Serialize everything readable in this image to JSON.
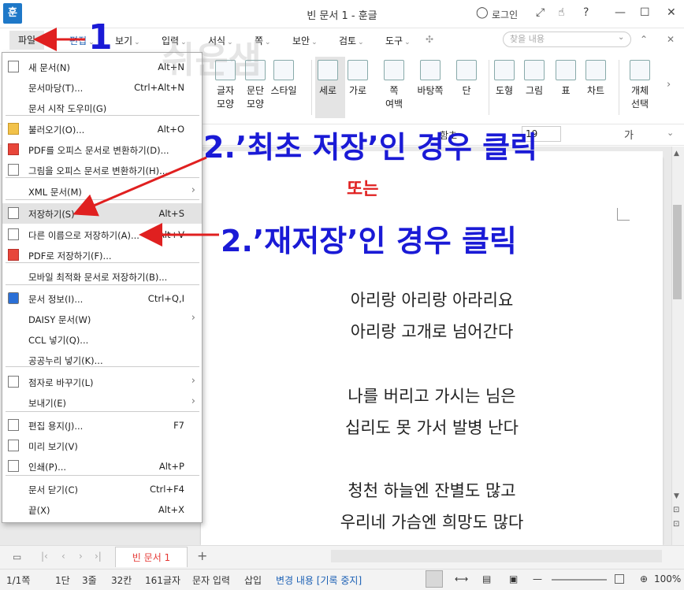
{
  "window": {
    "title": "빈 문서 1 - 훈글",
    "app_logo": "훈",
    "login_label": "로그인",
    "help_label": "?"
  },
  "menubar": {
    "items": [
      "파일",
      "편집",
      "보기",
      "입력",
      "서식",
      "쪽",
      "보안",
      "검토",
      "도구"
    ],
    "search_placeholder": "찾을 내용"
  },
  "toolbar": {
    "tools": [
      {
        "label": "글자",
        "label2": "모양",
        "icon": "char-shape-icon"
      },
      {
        "label": "문단",
        "label2": "모양",
        "icon": "para-shape-icon"
      },
      {
        "label": "스타일",
        "label2": "",
        "icon": "style-icon"
      },
      {
        "label": "세로",
        "label2": "",
        "icon": "portrait-icon"
      },
      {
        "label": "가로",
        "label2": "",
        "icon": "landscape-icon"
      },
      {
        "label": "쪽",
        "label2": "여백",
        "icon": "margin-icon"
      },
      {
        "label": "바탕쪽",
        "label2": "",
        "icon": "master-page-icon"
      },
      {
        "label": "단",
        "label2": "",
        "icon": "columns-icon"
      },
      {
        "label": "도형",
        "label2": "",
        "icon": "shape-icon"
      },
      {
        "label": "그림",
        "label2": "",
        "icon": "picture-icon"
      },
      {
        "label": "표",
        "label2": "",
        "icon": "table-icon"
      },
      {
        "label": "차트",
        "label2": "",
        "icon": "chart-icon"
      },
      {
        "label": "개체",
        "label2": "선택",
        "icon": "select-object-icon"
      }
    ]
  },
  "formatbar": {
    "font_partial": "함초",
    "size": "19",
    "sample_char": "가"
  },
  "file_menu": {
    "items": [
      {
        "label": "새 문서(N)",
        "shortcut": "Alt+N",
        "arrow": ""
      },
      {
        "label": "문서마당(T)...",
        "shortcut": "Ctrl+Alt+N",
        "arrow": ""
      },
      {
        "label": "문서 시작 도우미(G)",
        "shortcut": "",
        "arrow": ""
      },
      {
        "label": "불러오기(O)...",
        "shortcut": "Alt+O",
        "arrow": ""
      },
      {
        "label": "PDF를 오피스 문서로 변환하기(D)...",
        "shortcut": "",
        "arrow": ""
      },
      {
        "label": "그림을 오피스 문서로 변환하기(H)...",
        "shortcut": "",
        "arrow": ""
      },
      {
        "label": "XML 문서(M)",
        "shortcut": "",
        "arrow": "›"
      },
      {
        "label": "저장하기(S)",
        "shortcut": "Alt+S",
        "arrow": ""
      },
      {
        "label": "다른 이름으로 저장하기(A)...",
        "shortcut": "Alt+V",
        "arrow": ""
      },
      {
        "label": "PDF로 저장하기(F)...",
        "shortcut": "",
        "arrow": ""
      },
      {
        "label": "모바일 최적화 문서로 저장하기(B)...",
        "shortcut": "",
        "arrow": ""
      },
      {
        "label": "문서 정보(I)...",
        "shortcut": "Ctrl+Q,I",
        "arrow": ""
      },
      {
        "label": "DAISY 문서(W)",
        "shortcut": "",
        "arrow": "›"
      },
      {
        "label": "CCL 넣기(Q)...",
        "shortcut": "",
        "arrow": ""
      },
      {
        "label": "공공누리 넣기(K)...",
        "shortcut": "",
        "arrow": ""
      },
      {
        "label": "점자로 바꾸기(L)",
        "shortcut": "",
        "arrow": "›"
      },
      {
        "label": "보내기(E)",
        "shortcut": "",
        "arrow": "›"
      },
      {
        "label": "편집 용지(J)...",
        "shortcut": "F7",
        "arrow": ""
      },
      {
        "label": "미리 보기(V)",
        "shortcut": "",
        "arrow": ""
      },
      {
        "label": "인쇄(P)...",
        "shortcut": "Alt+P",
        "arrow": ""
      },
      {
        "label": "문서 닫기(C)",
        "shortcut": "Ctrl+F4",
        "arrow": ""
      },
      {
        "label": "끝(X)",
        "shortcut": "Alt+X",
        "arrow": ""
      }
    ]
  },
  "document": {
    "lines": [
      "아리랑 아리랑 아라리요",
      "아리랑 고개로 넘어간다",
      "나를 버리고 가시는 님은",
      "십리도 못 가서 발병 난다",
      "청천 하늘엔 잔별도 많고",
      "우리네 가슴엔 희망도 많다"
    ]
  },
  "tabs": {
    "doc_tab": "빈 문서 1",
    "add": "+"
  },
  "statusbar": {
    "page": "1/1쪽",
    "column": "1단",
    "line": "3줄",
    "col": "32칸",
    "chars": "161글자",
    "mode": "문자 입력",
    "insert": "삽입",
    "track": "변경 내용 [기록 중지]",
    "zoom": "100%"
  },
  "annotations": {
    "step1": "1",
    "step2_first": "2.’최초 저장’인 경우 클릭",
    "or": "또는",
    "step2_resave": "2.’재저장’인 경우 클릭",
    "watermark": "쉬운샘"
  },
  "colors": {
    "annotation_blue": "#1a1ad6",
    "annotation_red": "#e02020",
    "tab_active_text": "#e53935"
  }
}
